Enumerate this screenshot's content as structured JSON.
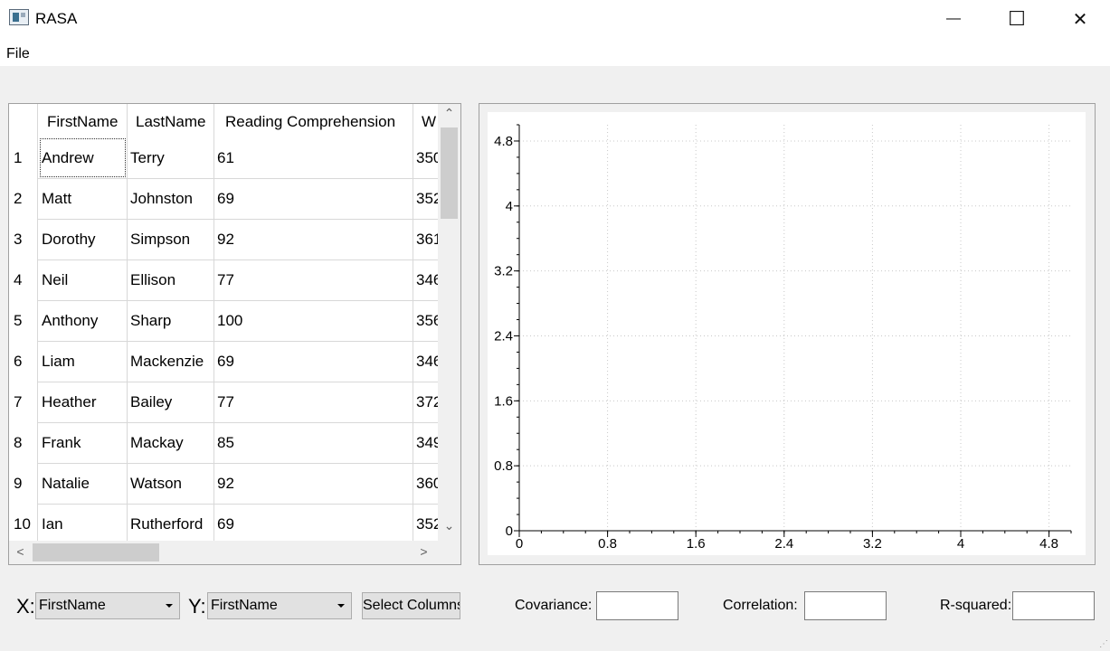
{
  "window": {
    "title": "RASA",
    "minimize_glyph": "—",
    "maximize_glyph": "☐",
    "close_glyph": "✕",
    "icon": "app-window-icon"
  },
  "menu": {
    "items": [
      "File"
    ]
  },
  "table": {
    "columns": [
      "FirstName",
      "LastName",
      "Reading Comprehension",
      "W"
    ],
    "rows": [
      {
        "num": "1",
        "first": "Andrew",
        "last": "Terry",
        "reading": "61",
        "w": "350"
      },
      {
        "num": "2",
        "first": "Matt",
        "last": "Johnston",
        "reading": "69",
        "w": "352"
      },
      {
        "num": "3",
        "first": "Dorothy",
        "last": "Simpson",
        "reading": "92",
        "w": "361"
      },
      {
        "num": "4",
        "first": "Neil",
        "last": "Ellison",
        "reading": "77",
        "w": "346"
      },
      {
        "num": "5",
        "first": "Anthony",
        "last": "Sharp",
        "reading": "100",
        "w": "356"
      },
      {
        "num": "6",
        "first": "Liam",
        "last": "Mackenzie",
        "reading": "69",
        "w": "346"
      },
      {
        "num": "7",
        "first": "Heather",
        "last": "Bailey",
        "reading": "77",
        "w": "372"
      },
      {
        "num": "8",
        "first": "Frank",
        "last": "Mackay",
        "reading": "85",
        "w": "349"
      },
      {
        "num": "9",
        "first": "Natalie",
        "last": "Watson",
        "reading": "92",
        "w": "360"
      },
      {
        "num": "10",
        "first": "Ian",
        "last": "Rutherford",
        "reading": "69",
        "w": "352"
      }
    ],
    "scroll_up_glyph": "⌃",
    "scroll_down_glyph": "⌄",
    "scroll_left_glyph": "<",
    "scroll_right_glyph": ">"
  },
  "chart_data": {
    "type": "scatter",
    "x_ticks": [
      "0",
      "0.8",
      "1.6",
      "2.4",
      "3.2",
      "4",
      "4.8"
    ],
    "y_ticks": [
      "0",
      "0.8",
      "1.6",
      "2.4",
      "3.2",
      "4",
      "4.8"
    ],
    "xlim": [
      0,
      5.0
    ],
    "ylim": [
      0,
      5.0
    ],
    "grid": true,
    "series": []
  },
  "controls": {
    "x_label": "X:",
    "x_value": "FirstName",
    "y_label": "Y:",
    "y_value": "FirstName",
    "select_columns_label": "Select Columns",
    "covariance_label": "Covariance:",
    "covariance_value": "",
    "correlation_label": "Correlation:",
    "correlation_value": "",
    "rsquared_label": "R-squared:",
    "rsquared_value": ""
  }
}
